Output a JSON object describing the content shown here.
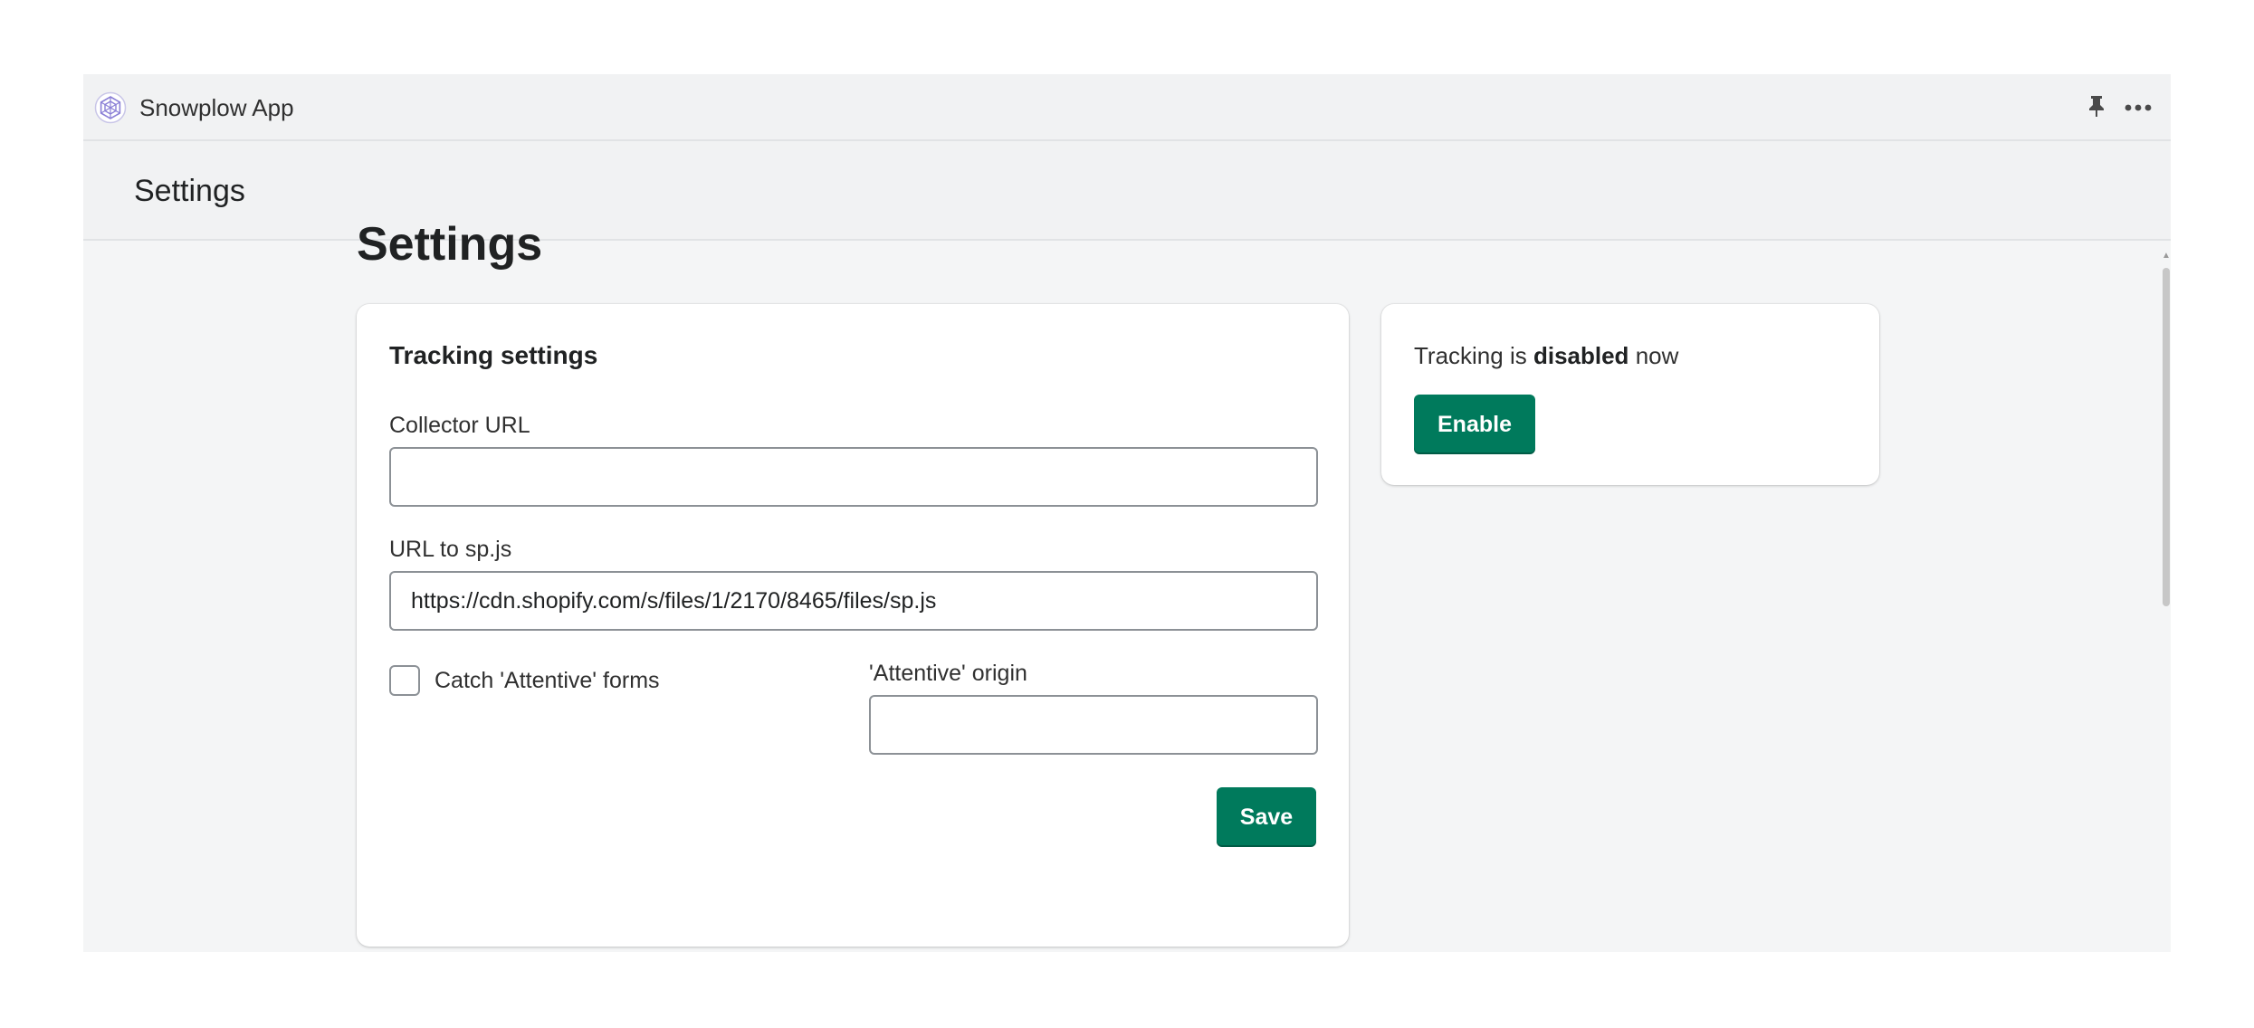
{
  "app": {
    "name": "Snowplow App",
    "title": "Settings"
  },
  "icons": {
    "logo": "snowplow-hexagon-logo-icon",
    "pin": "pin-icon",
    "more": "more-horizontal-icon"
  },
  "page": {
    "heading": "Settings"
  },
  "tracking_settings": {
    "title": "Tracking settings",
    "collector_url": {
      "label": "Collector URL",
      "value": ""
    },
    "sp_js_url": {
      "label": "URL to sp.js",
      "value": "https://cdn.shopify.com/s/files/1/2170/8465/files/sp.js"
    },
    "catch_attentive": {
      "label": "Catch 'Attentive' forms",
      "checked": false
    },
    "attentive_origin": {
      "label": "'Attentive' origin",
      "value": ""
    },
    "save_label": "Save"
  },
  "tracking_status": {
    "prefix": "Tracking is",
    "status": "disabled",
    "suffix": "now",
    "enable_label": "Enable"
  },
  "colors": {
    "primary": "#007a5c",
    "frame_bg": "#f4f5f6",
    "topbar_bg": "#f1f2f3",
    "logo_accent": "#8a7fd6"
  }
}
